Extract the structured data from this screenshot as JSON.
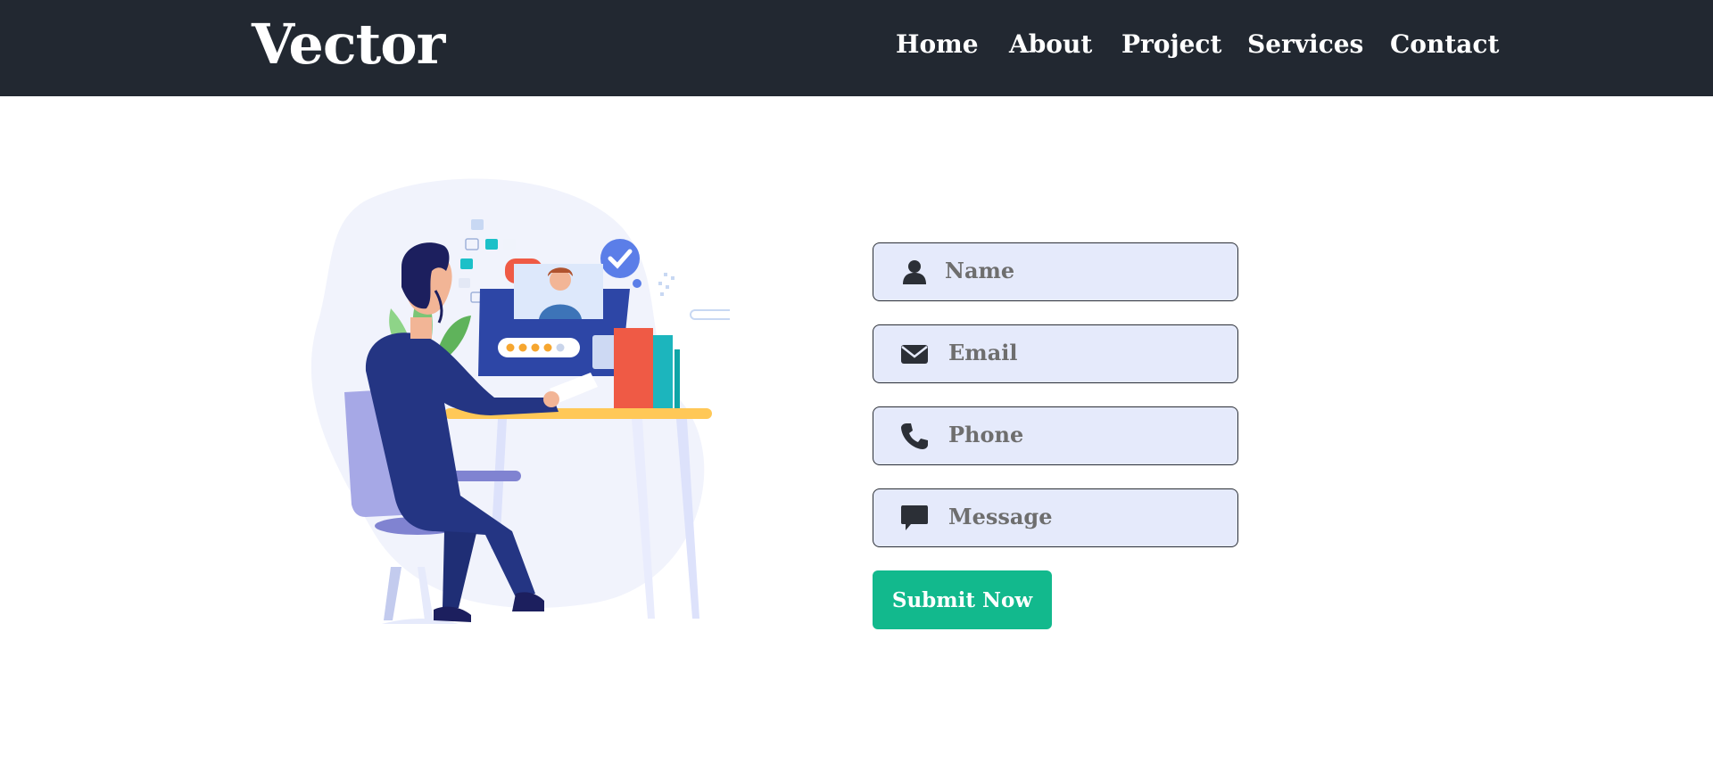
{
  "header": {
    "brand": "Vector",
    "nav": [
      {
        "label": "Home"
      },
      {
        "label": "About"
      },
      {
        "label": "Project"
      },
      {
        "label": "Services"
      },
      {
        "label": "Contact"
      }
    ],
    "background_color": "#222831"
  },
  "contact_form": {
    "fields": [
      {
        "placeholder": "Name",
        "icon": "user-icon"
      },
      {
        "placeholder": "Email",
        "icon": "envelope-icon"
      },
      {
        "placeholder": "Phone",
        "icon": "phone-icon"
      },
      {
        "placeholder": "Message",
        "icon": "message-icon"
      }
    ],
    "submit_label": "Submit Now",
    "field_background": "#e5eafb",
    "submit_color": "#12b98d"
  },
  "illustration": {
    "rating_stars": 4,
    "rating_max": 5
  }
}
